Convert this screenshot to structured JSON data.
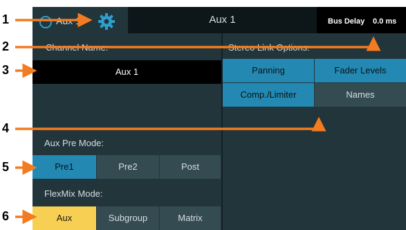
{
  "header": {
    "channel_short": "Aux 1",
    "title": "Aux 1",
    "bus_delay_label": "Bus Delay",
    "bus_delay_value": "0.0 ms"
  },
  "channel_name": {
    "label": "Channel Name:",
    "value": "Aux 1"
  },
  "stereo_link": {
    "label": "Stereo Link Options:",
    "options": [
      "Panning",
      "Fader Levels",
      "Comp./Limiter",
      "Names"
    ]
  },
  "aux_pre_mode": {
    "label": "Aux Pre Mode:",
    "options": [
      "Pre1",
      "Pre2",
      "Post"
    ],
    "selected": "Pre1"
  },
  "flexmix_mode": {
    "label": "FlexMix Mode:",
    "options": [
      "Aux",
      "Subgroup",
      "Matrix"
    ],
    "selected": "Aux"
  },
  "callouts": [
    "1",
    "2",
    "3",
    "4",
    "5",
    "6"
  ],
  "colors": {
    "panel": "#22353b",
    "active_blue": "#2389b3",
    "active_yellow": "#f7cf52",
    "arrow_orange": "#f47b20"
  },
  "icons": [
    "channel-circle-icon",
    "gear-icon"
  ]
}
